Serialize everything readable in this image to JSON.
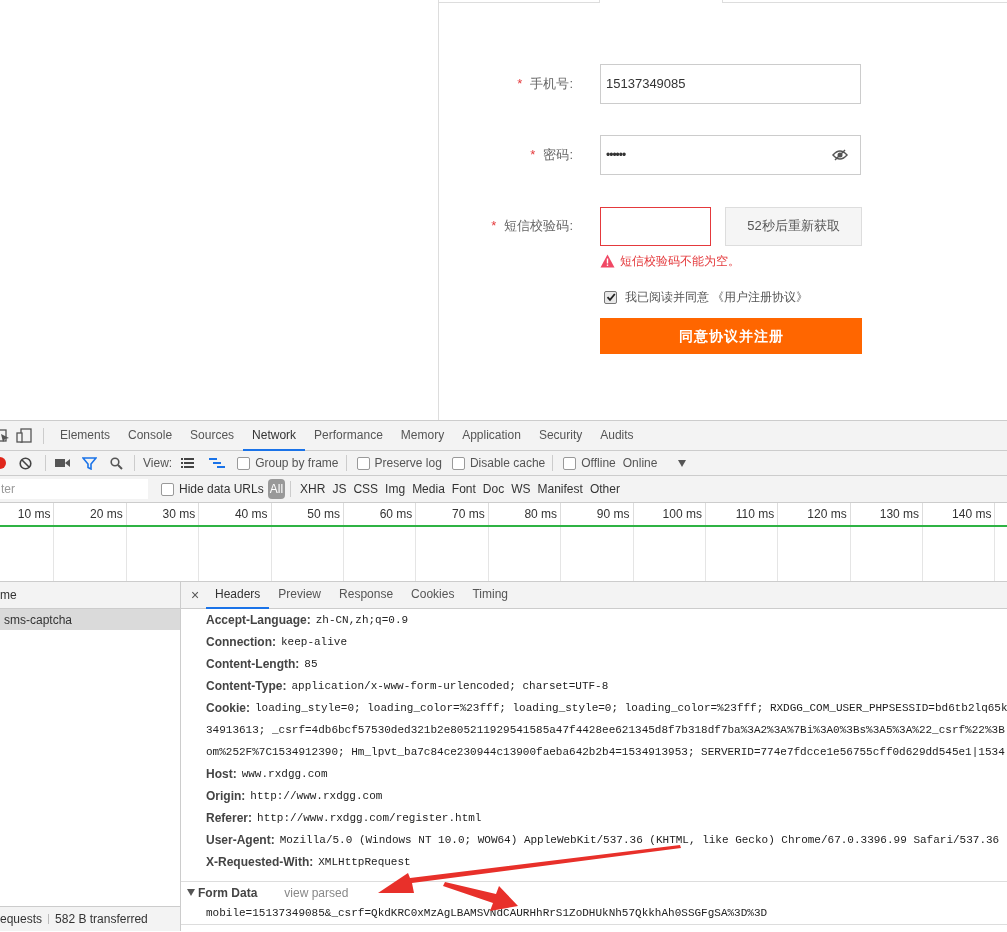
{
  "form": {
    "fields": [
      {
        "kind": "text",
        "marker": "*",
        "label": "手机号:",
        "value": "15137349085"
      },
      {
        "kind": "password",
        "marker": "*",
        "label": "密码:",
        "value": "••••••"
      },
      {
        "kind": "sms",
        "marker": "*",
        "label": "短信校验码:",
        "invalid": true,
        "button": "52秒后重新获取"
      }
    ],
    "error_message": "短信校验码不能为空。",
    "agreement": {
      "text": "我已阅读并同意 《用户注册协议》",
      "checked": true
    },
    "submit": "同意协议并注册"
  },
  "devtools": {
    "tabs": [
      {
        "label": "Elements",
        "selected": false
      },
      {
        "label": "Console",
        "selected": false
      },
      {
        "label": "Sources",
        "selected": false
      },
      {
        "label": "Network",
        "selected": true
      },
      {
        "label": "Performance",
        "selected": false
      },
      {
        "label": "Memory",
        "selected": false
      },
      {
        "label": "Application",
        "selected": false
      },
      {
        "label": "Security",
        "selected": false
      },
      {
        "label": "Audits",
        "selected": false
      }
    ],
    "toolbar": {
      "view_label": "View:",
      "checkboxes": [
        {
          "label": "Group by frame",
          "checked": false
        },
        {
          "label": "Preserve log",
          "checked": false
        },
        {
          "label": "Disable cache",
          "checked": false
        },
        {
          "label": "Offline",
          "checked": false
        }
      ],
      "throttle": "Online"
    },
    "filter": {
      "placeholder": "ter",
      "hide_data_urls": {
        "label": "Hide data URLs",
        "checked": false
      },
      "types": [
        {
          "label": "All",
          "selected": true
        },
        {
          "label": "XHR",
          "selected": false
        },
        {
          "label": "JS",
          "selected": false
        },
        {
          "label": "CSS",
          "selected": false
        },
        {
          "label": "Img",
          "selected": false
        },
        {
          "label": "Media",
          "selected": false
        },
        {
          "label": "Font",
          "selected": false
        },
        {
          "label": "Doc",
          "selected": false
        },
        {
          "label": "WS",
          "selected": false
        },
        {
          "label": "Manifest",
          "selected": false
        },
        {
          "label": "Other",
          "selected": false
        }
      ]
    },
    "timeline_ticks": [
      "10 ms",
      "20 ms",
      "30 ms",
      "40 ms",
      "50 ms",
      "60 ms",
      "70 ms",
      "80 ms",
      "90 ms",
      "100 ms",
      "110 ms",
      "120 ms",
      "130 ms",
      "140 ms"
    ],
    "requests": {
      "column": "me",
      "rows": [
        {
          "name": "sms-captcha",
          "selected": true
        }
      ]
    },
    "status": [
      "equests",
      "582 B transferred"
    ],
    "detail": {
      "close": "×",
      "tabs": [
        {
          "label": "Headers",
          "selected": true
        },
        {
          "label": "Preview",
          "selected": false
        },
        {
          "label": "Response",
          "selected": false
        },
        {
          "label": "Cookies",
          "selected": false
        },
        {
          "label": "Timing",
          "selected": false
        }
      ],
      "headers": [
        {
          "name": "Accept-Language:",
          "lines": [
            "zh-CN,zh;q=0.9"
          ]
        },
        {
          "name": "Connection:",
          "lines": [
            "keep-alive"
          ]
        },
        {
          "name": "Content-Length:",
          "lines": [
            "85"
          ]
        },
        {
          "name": "Content-Type:",
          "lines": [
            "application/x-www-form-urlencoded; charset=UTF-8"
          ]
        },
        {
          "name": "Cookie:",
          "lines": [
            "loading_style=0; loading_color=%23fff; loading_style=0; loading_color=%23fff; RXDGG_COM_USER_PHPSESSID=bd6tb2lq65k",
            "34913613; _csrf=4db6bcf57530ded321b2e805211929541585a47f4428ee621345d8f7b318df7ba%3A2%3A%7Bi%3A0%3Bs%3A5%3A%22_csrf%22%3B",
            "om%252F%7C1534912390; Hm_lpvt_ba7c84ce230944c13900faeba642b2b4=1534913953; SERVERID=774e7fdcce1e56755cff0d629dd545e1|1534"
          ]
        },
        {
          "name": "Host:",
          "lines": [
            "www.rxdgg.com"
          ]
        },
        {
          "name": "Origin:",
          "lines": [
            "http://www.rxdgg.com"
          ]
        },
        {
          "name": "Referer:",
          "lines": [
            "http://www.rxdgg.com/register.html"
          ]
        },
        {
          "name": "User-Agent:",
          "lines": [
            "Mozilla/5.0 (Windows NT 10.0; WOW64) AppleWebKit/537.36 (KHTML, like Gecko) Chrome/67.0.3396.99 Safari/537.36"
          ]
        },
        {
          "name": "X-Requested-With:",
          "lines": [
            "XMLHttpRequest"
          ]
        }
      ],
      "form_data": {
        "title": "Form Data",
        "toggle": "view parsed",
        "expanded": true,
        "value": "mobile=15137349085&_csrf=QkdKRC0xMzAgLBAMSVNdCAURHhRrS1ZoDHUkNh57QkkhAh0SSGFgSA%3D%3D"
      }
    }
  }
}
